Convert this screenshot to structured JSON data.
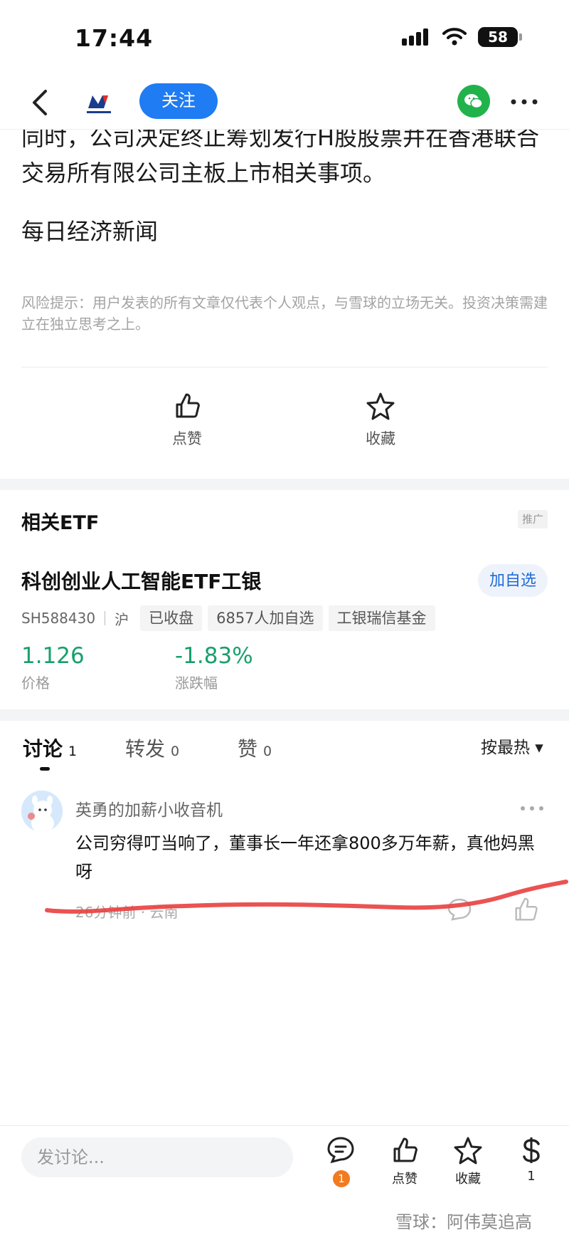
{
  "status": {
    "time": "17:44",
    "battery": "58"
  },
  "nav": {
    "follow_label": "关注"
  },
  "article": {
    "paragraph1": "同时，公司决定终止筹划发行H股股票并在香港联合交易所有限公司主板上市相关事项。",
    "paragraph2": "每日经济新闻",
    "risk_notice": "风险提示：用户发表的所有文章仅代表个人观点，与雪球的立场无关。投资决策需建立在独立思考之上。"
  },
  "actions": {
    "like": "点赞",
    "favorite": "收藏"
  },
  "etf": {
    "section_title": "相关ETF",
    "promo": "推广",
    "name": "科创创业人工智能ETF工银",
    "add_watch": "加自选",
    "code": "SH588430",
    "market": "沪",
    "tags": [
      "已收盘",
      "6857人加自选",
      "工银瑞信基金"
    ],
    "price": "1.126",
    "price_label": "价格",
    "change": "-1.83%",
    "change_label": "涨跌幅",
    "value_color": "#17a06b"
  },
  "tabs": [
    {
      "label": "讨论",
      "count": "1"
    },
    {
      "label": "转发",
      "count": "0"
    },
    {
      "label": "赞",
      "count": "0"
    }
  ],
  "sort_label": "按最热 ▾",
  "comment": {
    "user": "英勇的加薪小收音机",
    "text": "公司穷得叮当响了，董事长一年还拿800多万年薪，真他妈黑呀",
    "time_location": "26分钟前 · 云南"
  },
  "bottom": {
    "input_placeholder": "发讨论...",
    "comment_badge": "1",
    "like": "点赞",
    "favorite": "收藏",
    "reward_count": "1"
  },
  "watermark": "雪球：阿伟莫追高",
  "accent_color": "#1f7cf2"
}
